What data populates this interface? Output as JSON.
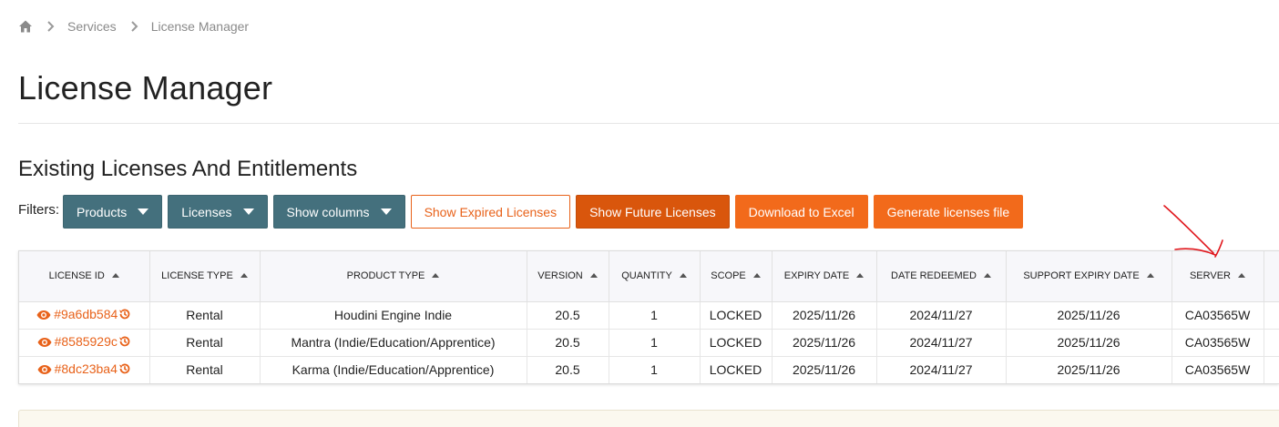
{
  "breadcrumb": {
    "home_icon": "home-icon",
    "items": [
      "Services",
      "License Manager"
    ]
  },
  "page": {
    "title": "License Manager",
    "section_title": "Existing Licenses And Entitlements"
  },
  "filters": {
    "label": "Filters:",
    "products": "Products",
    "licenses": "Licenses",
    "show_columns": "Show columns",
    "show_expired": "Show Expired Licenses",
    "show_future": "Show Future Licenses",
    "download_excel": "Download to Excel",
    "generate_file": "Generate licenses file"
  },
  "table": {
    "headers": [
      "LICENSE ID",
      "LICENSE TYPE",
      "PRODUCT TYPE",
      "VERSION",
      "QUANTITY",
      "SCOPE",
      "EXPIRY DATE",
      "DATE REDEEMED",
      "SUPPORT EXPIRY DATE",
      "SERVER"
    ],
    "rows": [
      {
        "id": "#9a6db584",
        "type": "Rental",
        "product": "Houdini Engine Indie",
        "version": "20.5",
        "quantity": "1",
        "scope": "LOCKED",
        "expiry": "2025/11/26",
        "redeemed": "2024/11/27",
        "support_expiry": "2025/11/26",
        "server": "CA03565W"
      },
      {
        "id": "#8585929c",
        "type": "Rental",
        "product": "Mantra (Indie/Education/Apprentice)",
        "version": "20.5",
        "quantity": "1",
        "scope": "LOCKED",
        "expiry": "2025/11/26",
        "redeemed": "2024/11/27",
        "support_expiry": "2025/11/26",
        "server": "CA03565W"
      },
      {
        "id": "#8dc23ba4",
        "type": "Rental",
        "product": "Karma (Indie/Education/Apprentice)",
        "version": "20.5",
        "quantity": "1",
        "scope": "LOCKED",
        "expiry": "2025/11/26",
        "redeemed": "2024/11/27",
        "support_expiry": "2025/11/26",
        "server": "CA03565W"
      }
    ]
  },
  "colors": {
    "accent_orange": "#f26a1b",
    "dark_orange": "#d9560c",
    "teal": "#44707d",
    "annotation_red": "#e0151b"
  }
}
